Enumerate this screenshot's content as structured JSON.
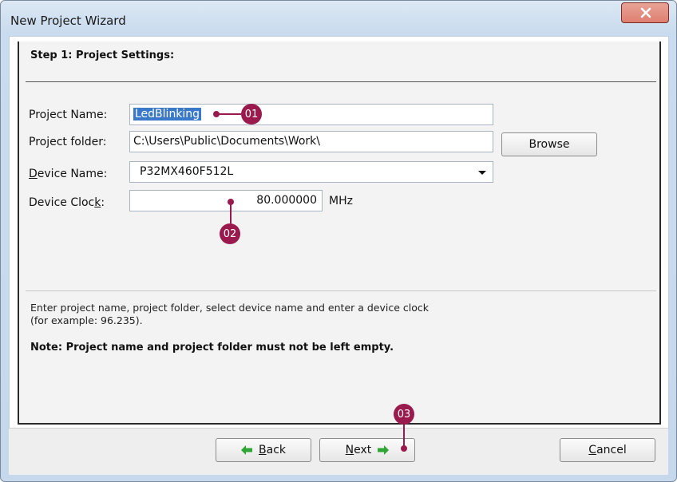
{
  "window": {
    "title": "New Project Wizard"
  },
  "step": {
    "title": "Step 1: Project Settings:"
  },
  "form": {
    "project_name": {
      "label": "Project Name:",
      "value": "LedBlinking"
    },
    "project_folder": {
      "label": "Project folder:",
      "value": "C:\\Users\\Public\\Documents\\Work\\"
    },
    "device_name": {
      "label_u": "D",
      "label_rest": "evice Name:",
      "value": "P32MX460F512L"
    },
    "device_clock": {
      "label_pre": "Device Cloc",
      "label_u": "k",
      "label_post": ":",
      "value": "80.000000",
      "unit": "MHz"
    }
  },
  "buttons": {
    "browse": "Browse",
    "back_u": "B",
    "back_rest": "ack",
    "next_u": "N",
    "next_rest": "ext",
    "cancel_u": "C",
    "cancel_rest": "ancel"
  },
  "description": {
    "line1": "Enter project name, project folder, select device name and enter a device clock",
    "line2": "(for example: 96.235)."
  },
  "note": "Note: Project name and project folder must not be left empty.",
  "markers": {
    "m1": "01",
    "m2": "02",
    "m3": "03"
  },
  "colors": {
    "marker": "#9a1a4e",
    "selection": "#3a79c9",
    "arrow_green": "#2fa536"
  },
  "icons": {
    "close": "close-icon",
    "back": "green-arrow-left-icon",
    "next": "green-arrow-right-icon",
    "dropdown": "chevron-down-icon"
  }
}
